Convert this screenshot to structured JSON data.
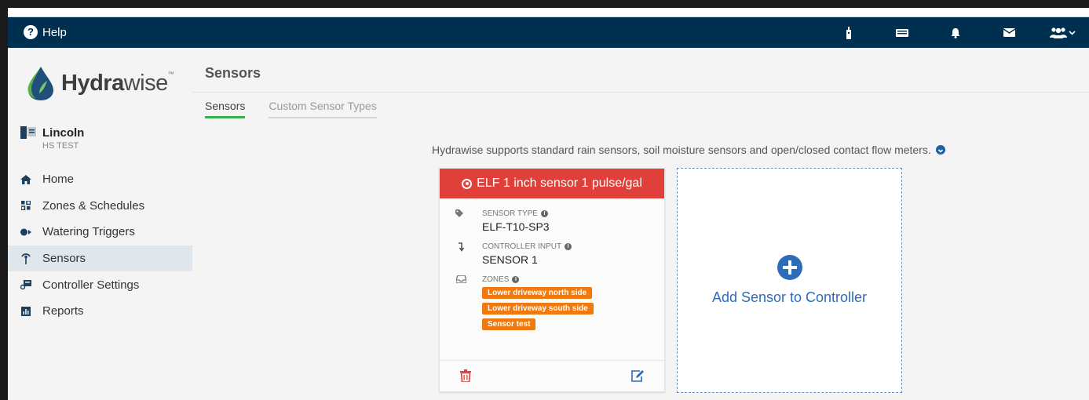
{
  "topbar": {
    "help_label": "Help",
    "icons": [
      "remote-controller-icon",
      "keyboard-icon",
      "bell-icon",
      "envelope-icon",
      "users-icon"
    ]
  },
  "brand": {
    "logo_text_bold": "Hydra",
    "logo_text_rest": "wise",
    "trademark": "™"
  },
  "controller": {
    "name": "Lincoln",
    "subtitle": "HS TEST"
  },
  "sidebar": {
    "items": [
      {
        "label": "Home",
        "icon": "home-icon"
      },
      {
        "label": "Zones & Schedules",
        "icon": "zones-grid-icon"
      },
      {
        "label": "Watering Triggers",
        "icon": "triggers-icon"
      },
      {
        "label": "Sensors",
        "icon": "sensor-antenna-icon",
        "active": true
      },
      {
        "label": "Controller Settings",
        "icon": "controller-settings-icon"
      },
      {
        "label": "Reports",
        "icon": "reports-icon"
      }
    ]
  },
  "main": {
    "title": "Sensors",
    "tabs": [
      {
        "label": "Sensors",
        "active": true
      },
      {
        "label": "Custom Sensor Types",
        "active": false
      }
    ],
    "info_text": "Hydrawise supports standard rain sensors, soil moisture sensors and open/closed contact flow meters."
  },
  "sensor_card": {
    "title": "ELF 1 inch sensor 1 pulse/gal",
    "header_color": "#e0403a",
    "sensor_type_label": "SENSOR TYPE",
    "sensor_type_value": "ELF-T10-SP3",
    "controller_input_label": "CONTROLLER INPUT",
    "controller_input_value": "SENSOR 1",
    "zones_label": "ZONES",
    "zones": [
      "Lower driveway north side",
      "Lower driveway south side",
      "Sensor test"
    ],
    "zone_tag_color": "#f07a0f"
  },
  "add_card": {
    "label": "Add Sensor to Controller"
  },
  "colors": {
    "topbar": "#00304f",
    "accent_blue": "#2d6cb8",
    "active_tab": "#36b24a"
  }
}
